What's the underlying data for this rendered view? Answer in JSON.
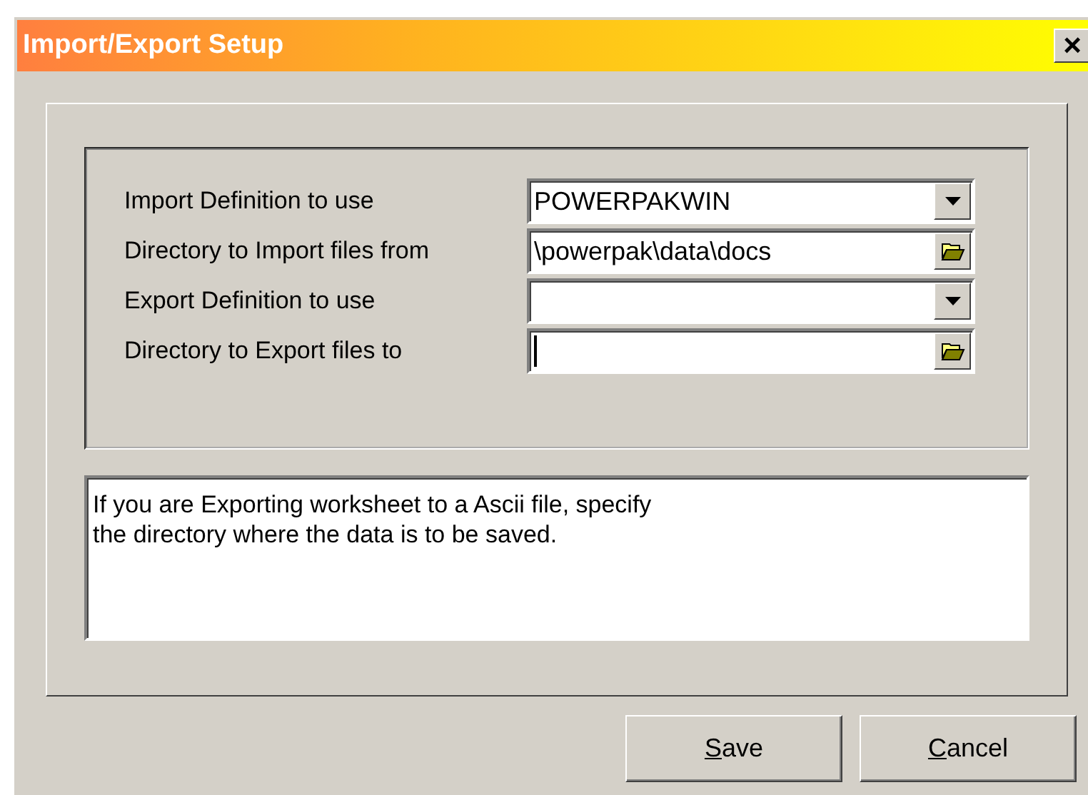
{
  "window": {
    "title": "Import/Export Setup",
    "close": "×"
  },
  "fields": [
    {
      "label": "Import Definition to use",
      "kind": "dropdown",
      "value": "POWERPAKWIN",
      "focused": false
    },
    {
      "label": "Directory to Import files from",
      "kind": "folder",
      "value": "\\powerpak\\data\\docs",
      "focused": false
    },
    {
      "label": "Export Definition to use",
      "kind": "dropdown",
      "focused": false
    },
    {
      "label": "Directory to Export files to",
      "kind": "folder",
      "focused": true
    }
  ],
  "help_text": "If you are Exporting worksheet to a Ascii file, specify\nthe directory where the data is to be saved.",
  "buttons": [
    {
      "label": "Save",
      "underline_first": true
    },
    {
      "label": "Cancel",
      "underline_first": true
    }
  ]
}
